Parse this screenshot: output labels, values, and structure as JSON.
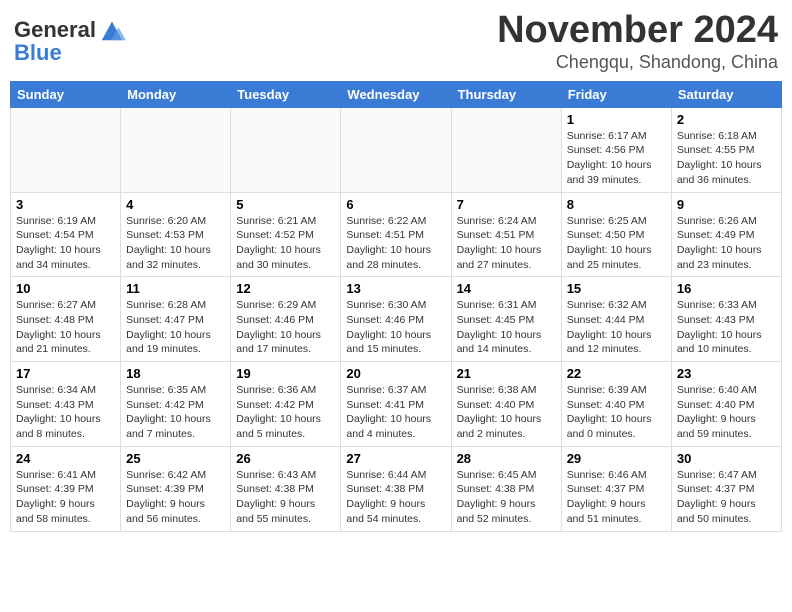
{
  "logo": {
    "line1": "General",
    "line2": "Blue"
  },
  "title": "November 2024",
  "subtitle": "Chengqu, Shandong, China",
  "weekdays": [
    "Sunday",
    "Monday",
    "Tuesday",
    "Wednesday",
    "Thursday",
    "Friday",
    "Saturday"
  ],
  "weeks": [
    [
      {
        "day": "",
        "info": ""
      },
      {
        "day": "",
        "info": ""
      },
      {
        "day": "",
        "info": ""
      },
      {
        "day": "",
        "info": ""
      },
      {
        "day": "",
        "info": ""
      },
      {
        "day": "1",
        "info": "Sunrise: 6:17 AM\nSunset: 4:56 PM\nDaylight: 10 hours\nand 39 minutes."
      },
      {
        "day": "2",
        "info": "Sunrise: 6:18 AM\nSunset: 4:55 PM\nDaylight: 10 hours\nand 36 minutes."
      }
    ],
    [
      {
        "day": "3",
        "info": "Sunrise: 6:19 AM\nSunset: 4:54 PM\nDaylight: 10 hours\nand 34 minutes."
      },
      {
        "day": "4",
        "info": "Sunrise: 6:20 AM\nSunset: 4:53 PM\nDaylight: 10 hours\nand 32 minutes."
      },
      {
        "day": "5",
        "info": "Sunrise: 6:21 AM\nSunset: 4:52 PM\nDaylight: 10 hours\nand 30 minutes."
      },
      {
        "day": "6",
        "info": "Sunrise: 6:22 AM\nSunset: 4:51 PM\nDaylight: 10 hours\nand 28 minutes."
      },
      {
        "day": "7",
        "info": "Sunrise: 6:24 AM\nSunset: 4:51 PM\nDaylight: 10 hours\nand 27 minutes."
      },
      {
        "day": "8",
        "info": "Sunrise: 6:25 AM\nSunset: 4:50 PM\nDaylight: 10 hours\nand 25 minutes."
      },
      {
        "day": "9",
        "info": "Sunrise: 6:26 AM\nSunset: 4:49 PM\nDaylight: 10 hours\nand 23 minutes."
      }
    ],
    [
      {
        "day": "10",
        "info": "Sunrise: 6:27 AM\nSunset: 4:48 PM\nDaylight: 10 hours\nand 21 minutes."
      },
      {
        "day": "11",
        "info": "Sunrise: 6:28 AM\nSunset: 4:47 PM\nDaylight: 10 hours\nand 19 minutes."
      },
      {
        "day": "12",
        "info": "Sunrise: 6:29 AM\nSunset: 4:46 PM\nDaylight: 10 hours\nand 17 minutes."
      },
      {
        "day": "13",
        "info": "Sunrise: 6:30 AM\nSunset: 4:46 PM\nDaylight: 10 hours\nand 15 minutes."
      },
      {
        "day": "14",
        "info": "Sunrise: 6:31 AM\nSunset: 4:45 PM\nDaylight: 10 hours\nand 14 minutes."
      },
      {
        "day": "15",
        "info": "Sunrise: 6:32 AM\nSunset: 4:44 PM\nDaylight: 10 hours\nand 12 minutes."
      },
      {
        "day": "16",
        "info": "Sunrise: 6:33 AM\nSunset: 4:43 PM\nDaylight: 10 hours\nand 10 minutes."
      }
    ],
    [
      {
        "day": "17",
        "info": "Sunrise: 6:34 AM\nSunset: 4:43 PM\nDaylight: 10 hours\nand 8 minutes."
      },
      {
        "day": "18",
        "info": "Sunrise: 6:35 AM\nSunset: 4:42 PM\nDaylight: 10 hours\nand 7 minutes."
      },
      {
        "day": "19",
        "info": "Sunrise: 6:36 AM\nSunset: 4:42 PM\nDaylight: 10 hours\nand 5 minutes."
      },
      {
        "day": "20",
        "info": "Sunrise: 6:37 AM\nSunset: 4:41 PM\nDaylight: 10 hours\nand 4 minutes."
      },
      {
        "day": "21",
        "info": "Sunrise: 6:38 AM\nSunset: 4:40 PM\nDaylight: 10 hours\nand 2 minutes."
      },
      {
        "day": "22",
        "info": "Sunrise: 6:39 AM\nSunset: 4:40 PM\nDaylight: 10 hours\nand 0 minutes."
      },
      {
        "day": "23",
        "info": "Sunrise: 6:40 AM\nSunset: 4:40 PM\nDaylight: 9 hours\nand 59 minutes."
      }
    ],
    [
      {
        "day": "24",
        "info": "Sunrise: 6:41 AM\nSunset: 4:39 PM\nDaylight: 9 hours\nand 58 minutes."
      },
      {
        "day": "25",
        "info": "Sunrise: 6:42 AM\nSunset: 4:39 PM\nDaylight: 9 hours\nand 56 minutes."
      },
      {
        "day": "26",
        "info": "Sunrise: 6:43 AM\nSunset: 4:38 PM\nDaylight: 9 hours\nand 55 minutes."
      },
      {
        "day": "27",
        "info": "Sunrise: 6:44 AM\nSunset: 4:38 PM\nDaylight: 9 hours\nand 54 minutes."
      },
      {
        "day": "28",
        "info": "Sunrise: 6:45 AM\nSunset: 4:38 PM\nDaylight: 9 hours\nand 52 minutes."
      },
      {
        "day": "29",
        "info": "Sunrise: 6:46 AM\nSunset: 4:37 PM\nDaylight: 9 hours\nand 51 minutes."
      },
      {
        "day": "30",
        "info": "Sunrise: 6:47 AM\nSunset: 4:37 PM\nDaylight: 9 hours\nand 50 minutes."
      }
    ]
  ]
}
